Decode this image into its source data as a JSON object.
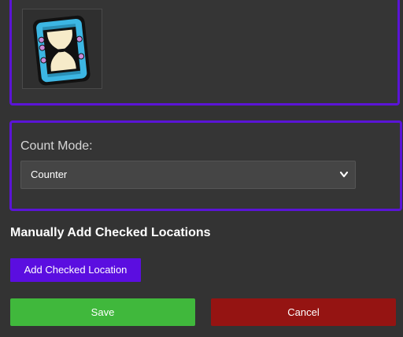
{
  "item_icon": {
    "name": "hourglass-icon"
  },
  "count_mode": {
    "label": "Count Mode:",
    "selected": "Counter"
  },
  "checked_locations": {
    "heading": "Manually Add Checked Locations",
    "add_button": "Add Checked Location"
  },
  "actions": {
    "save": "Save",
    "cancel": "Cancel"
  },
  "colors": {
    "accent_border": "#5b14d6",
    "add_button": "#5b0ee0",
    "save_button": "#40b83c",
    "cancel_button": "#951412"
  }
}
